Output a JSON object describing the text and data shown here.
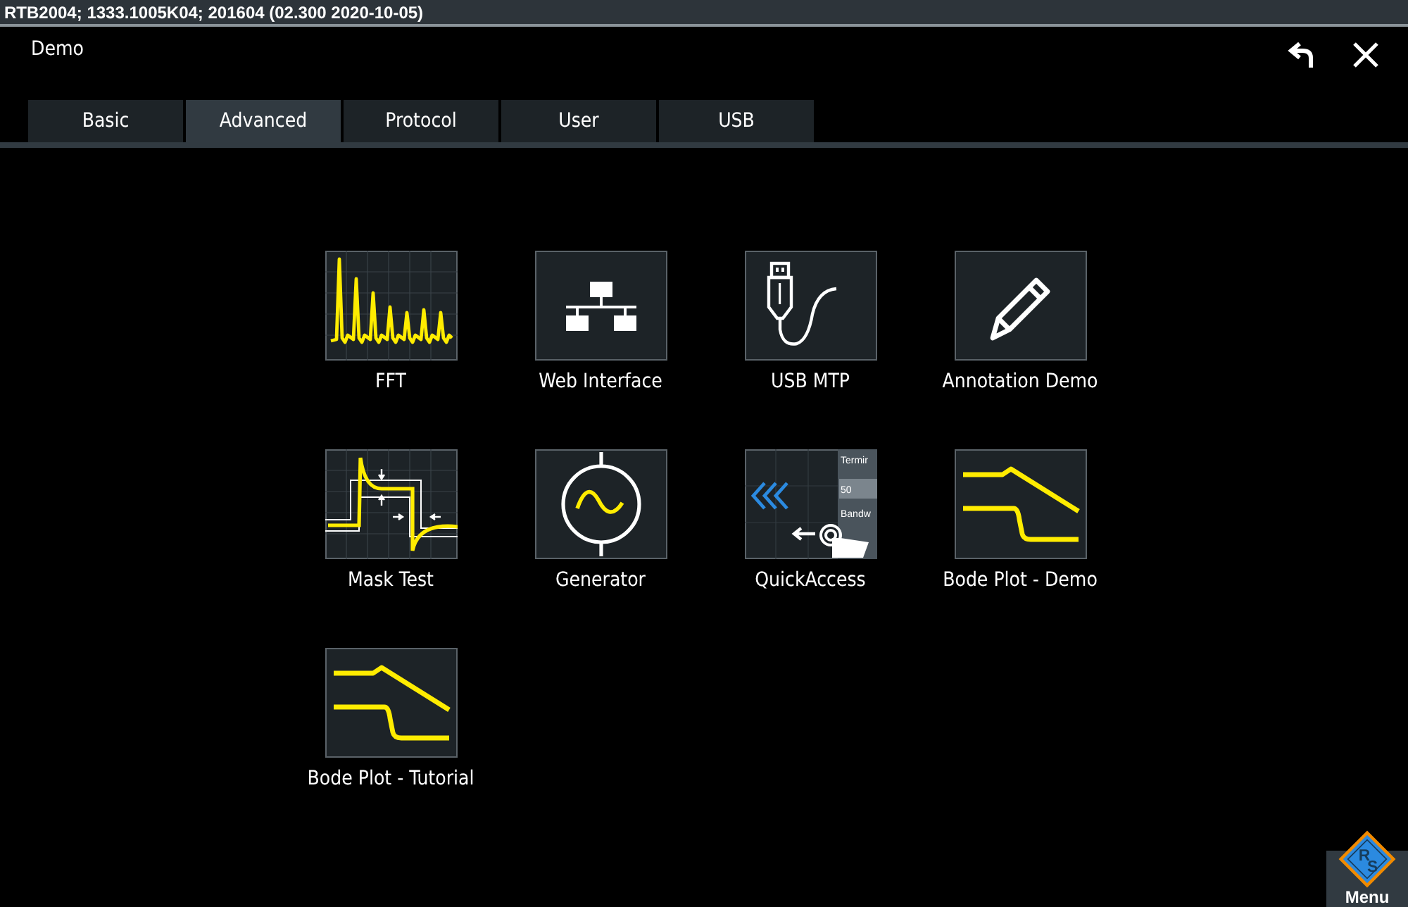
{
  "status_bar": {
    "text": "RTB2004; 1333.1005K04; 201604 (02.300 2020-10-05)"
  },
  "window": {
    "title": "Demo"
  },
  "tabs": [
    {
      "label": "Basic",
      "selected": false
    },
    {
      "label": "Advanced",
      "selected": true
    },
    {
      "label": "Protocol",
      "selected": false
    },
    {
      "label": "User",
      "selected": false
    },
    {
      "label": "USB",
      "selected": false
    }
  ],
  "apps": [
    {
      "label": "FFT",
      "kind": "fft"
    },
    {
      "label": "Web Interface",
      "kind": "network"
    },
    {
      "label": "USB MTP",
      "kind": "usb"
    },
    {
      "label": "Annotation Demo",
      "kind": "pencil"
    },
    {
      "label": "Mask Test",
      "kind": "mask"
    },
    {
      "label": "Generator",
      "kind": "generator"
    },
    {
      "label": "QuickAccess",
      "kind": "quickaccess",
      "panel_texts": [
        "Termir",
        "50",
        "Bandw"
      ]
    },
    {
      "label": "Bode Plot - Demo",
      "kind": "bode"
    },
    {
      "label": "Bode Plot - Tutorial",
      "kind": "bode"
    }
  ],
  "menu_button": {
    "label": "Menu",
    "logo_letters": [
      "R",
      "S"
    ]
  }
}
